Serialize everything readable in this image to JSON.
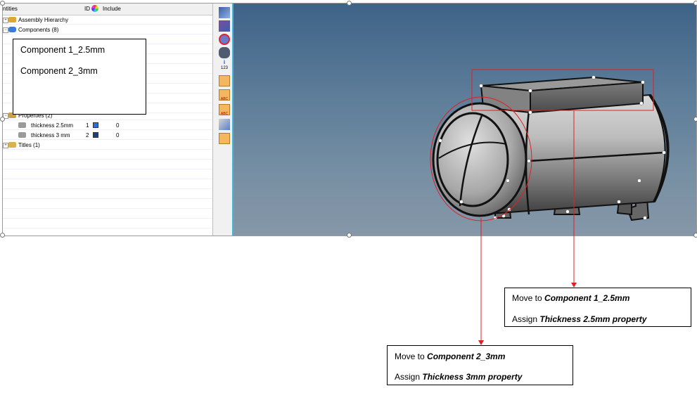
{
  "tree": {
    "header": {
      "entities": "ntities",
      "id": "ID",
      "include": "Include"
    },
    "rows": [
      {
        "label": "Assembly Hierarchy"
      },
      {
        "label": "Components (8)"
      },
      {
        "label": "Properties (2)"
      },
      {
        "label": "thickness 2.5mm",
        "id": "1",
        "include": "0",
        "color": "#2a6fe0"
      },
      {
        "label": "thickness 3 mm",
        "id": "2",
        "include": "0",
        "color": "#1d3f7a"
      },
      {
        "label": "Titles (1)"
      }
    ]
  },
  "toolbar": {
    "label_123": "123",
    "label_abc1": "ABC",
    "label_abc2": "ABC"
  },
  "components_popup": {
    "item1": "Component 1_2.5mm",
    "item2": "Component 2_3mm"
  },
  "callout1": {
    "line1_prefix": "Move to ",
    "line1_target": "Component 1_2.5mm",
    "line2_prefix": "Assign ",
    "line2_target": "Thickness 2.5mm property"
  },
  "callout2": {
    "line1_prefix": "Move to ",
    "line1_target": "Component 2_3mm",
    "line2_prefix": "Assign ",
    "line2_target": "Thickness 3mm property"
  },
  "colors": {
    "annotation_red": "#e02020",
    "toolbar_accent": "#45b6d6"
  }
}
